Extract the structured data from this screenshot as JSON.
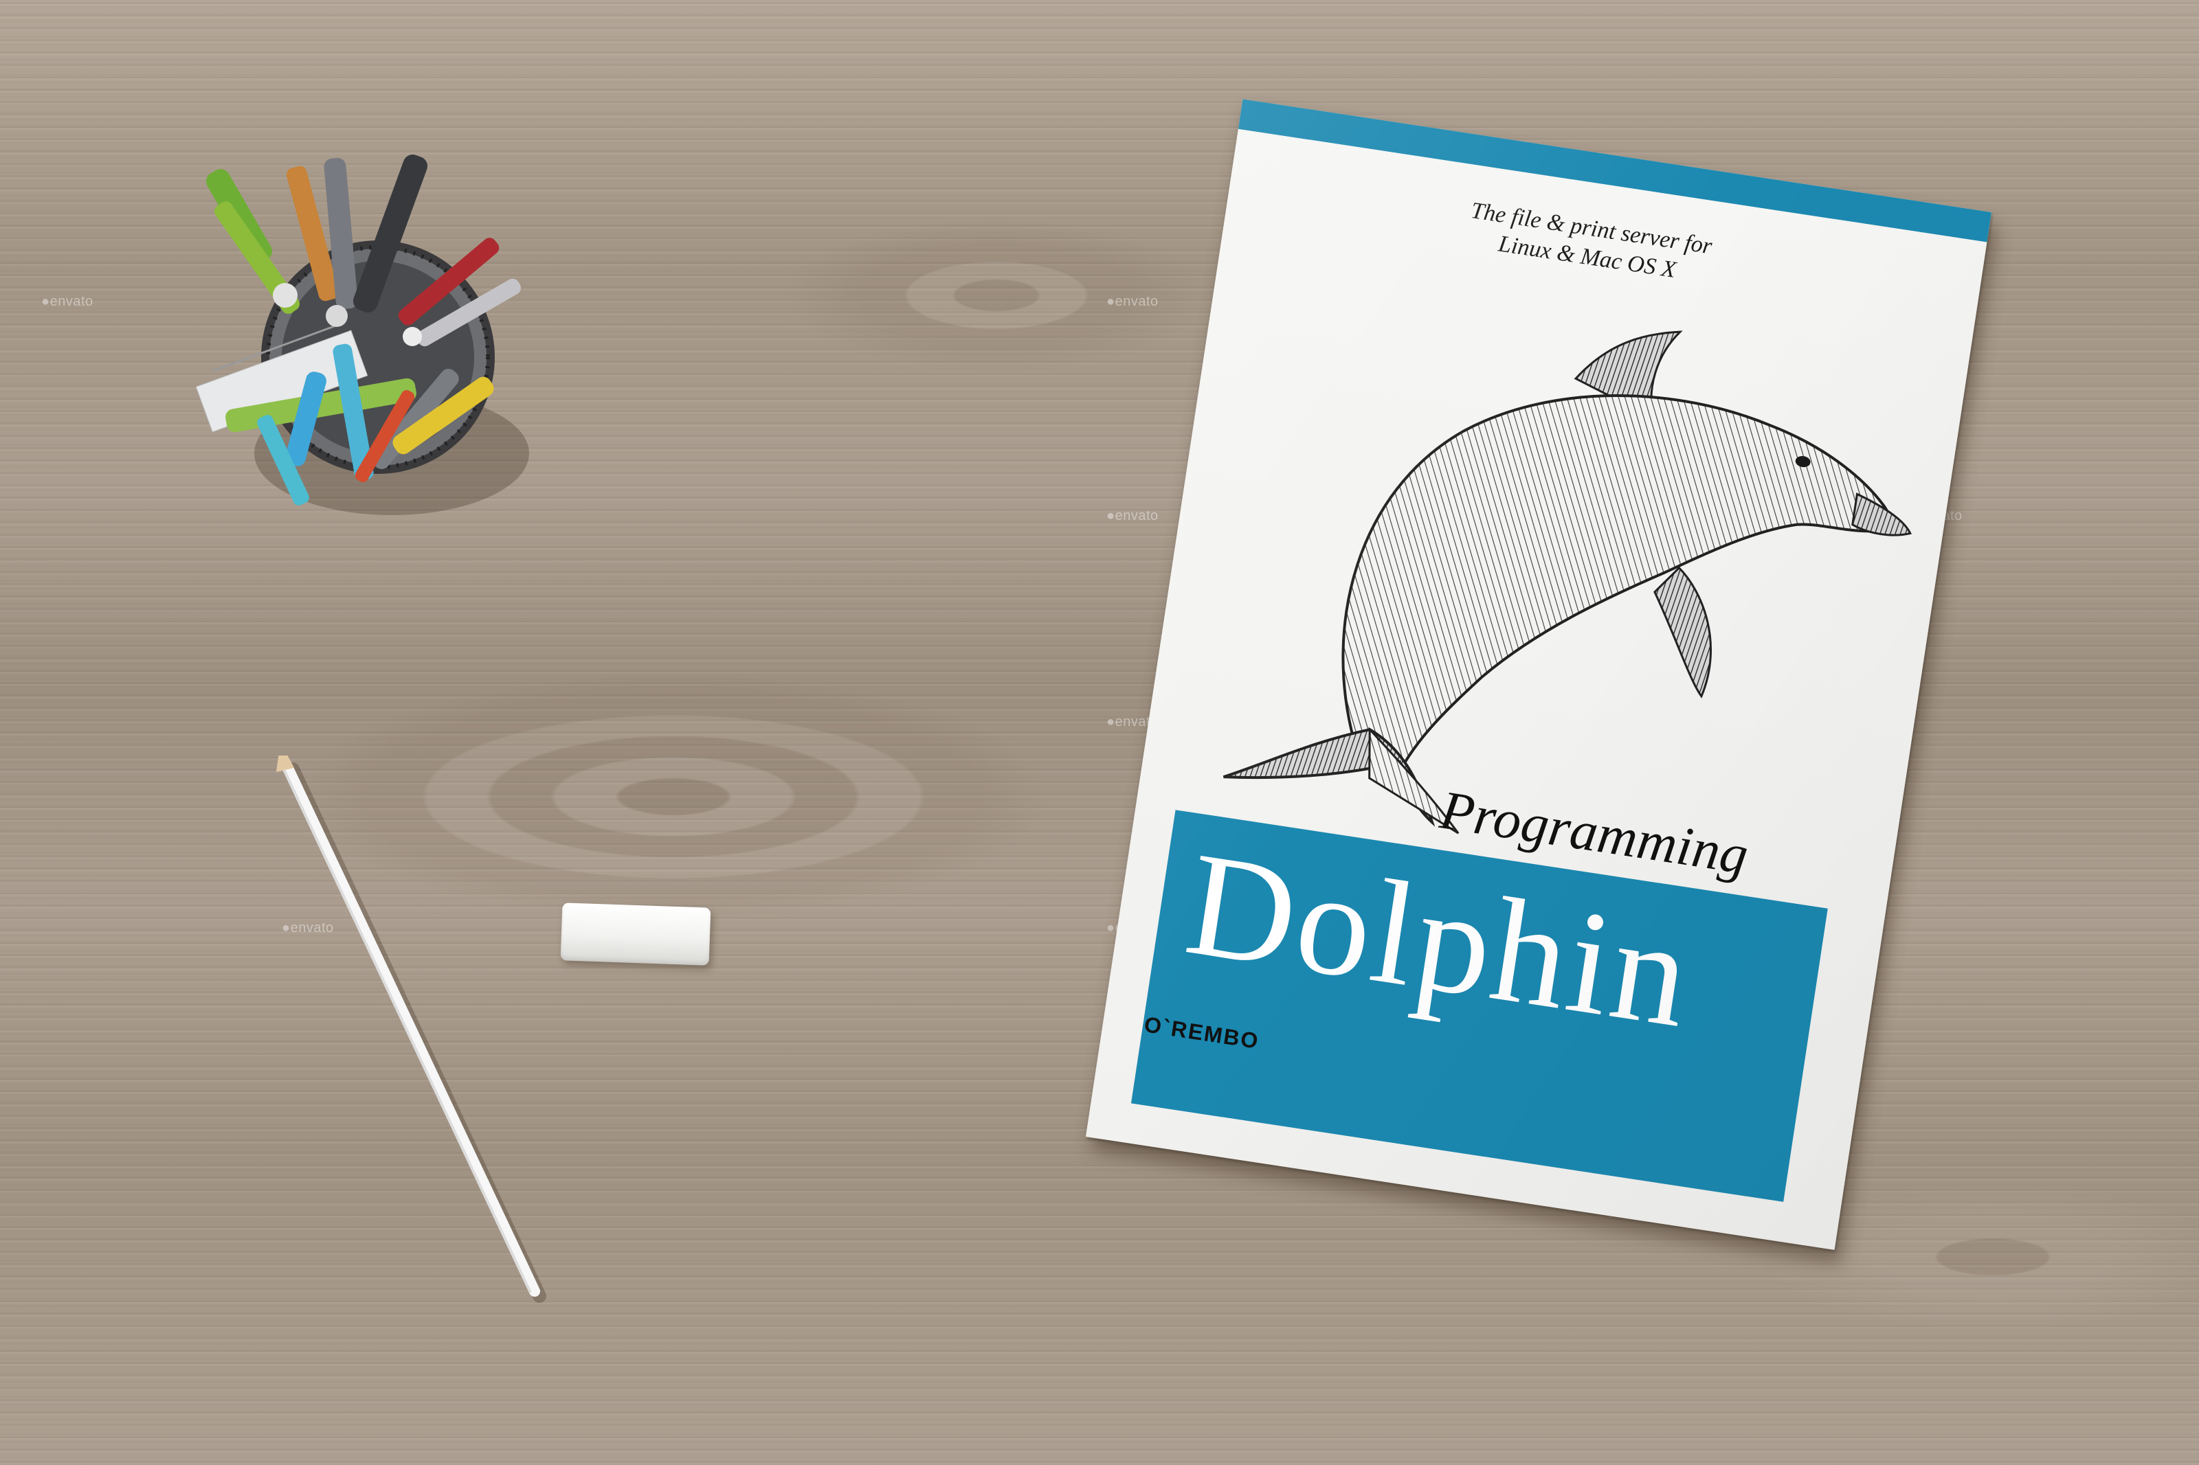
{
  "book": {
    "tagline_line1": "The file & print server for",
    "tagline_line2": "Linux & Mac OS X",
    "title_small": "Programming",
    "title_large": "Dolphin",
    "publisher": "O`REMBO",
    "accent_color": "#1c89b1"
  },
  "watermark": {
    "text": "envato",
    "icon": "envato-leaf-icon"
  },
  "scene": {
    "surface": "light oak wood desk",
    "objects": [
      "pen-cup-icon",
      "pencil-icon",
      "eraser-icon",
      "dolphin-illustration"
    ]
  }
}
